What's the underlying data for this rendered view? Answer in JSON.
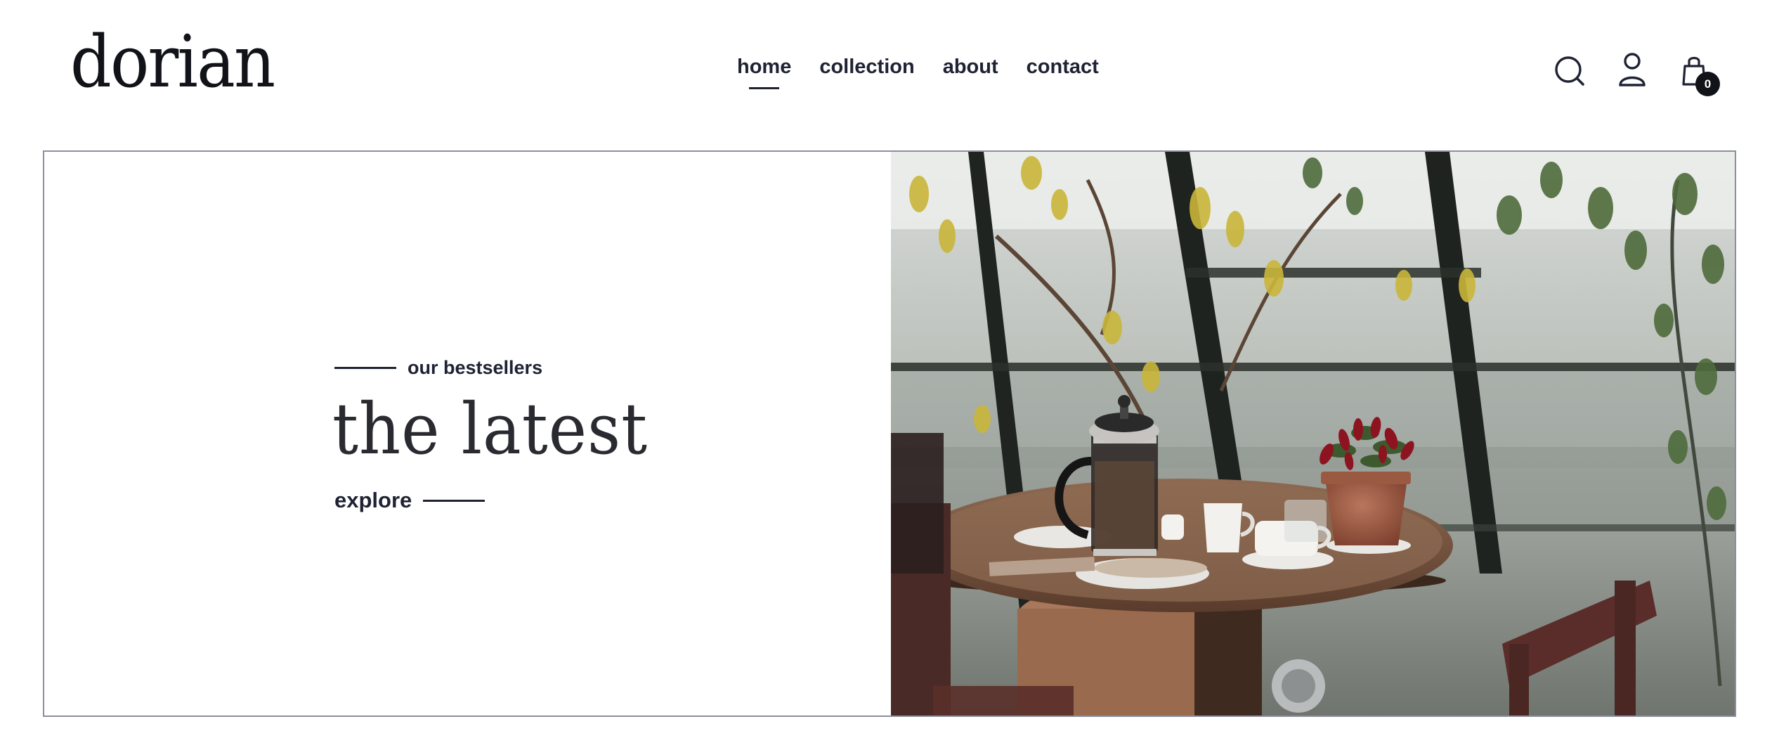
{
  "brand": {
    "logo_text": "dorian"
  },
  "nav": {
    "items": [
      {
        "label": "home",
        "active": true
      },
      {
        "label": "collection",
        "active": false
      },
      {
        "label": "about",
        "active": false
      },
      {
        "label": "contact",
        "active": false
      }
    ]
  },
  "header_actions": {
    "search_icon": "search-icon",
    "account_icon": "user-icon",
    "cart_icon": "shopping-bag-icon",
    "cart_count": "0"
  },
  "hero": {
    "eyebrow": "our bestsellers",
    "title": "the latest",
    "cta_label": "explore",
    "image_alt": "cafe table with french press, teapot, cups and potted plant in a greenhouse"
  },
  "colors": {
    "text_dark": "#1f2233",
    "logo": "#111319",
    "hero_border": "#8c8f9e",
    "background": "#ffffff",
    "badge": "#111319"
  }
}
